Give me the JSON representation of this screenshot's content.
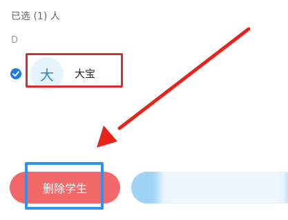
{
  "header": {
    "selected_count": "已选 (1) 人"
  },
  "group": {
    "letter": "D"
  },
  "student": {
    "avatar_char": "大",
    "name": "大宝",
    "selected": true
  },
  "actions": {
    "delete_label": "删除学生",
    "confirm_label": ""
  },
  "colors": {
    "delete_button": "#f2686a",
    "confirm_button": "#9ed3f6",
    "check": "#1a7be0",
    "highlight_red": "#e02a2a",
    "highlight_blue": "#2a95ef",
    "arrow": "#e8231a"
  }
}
